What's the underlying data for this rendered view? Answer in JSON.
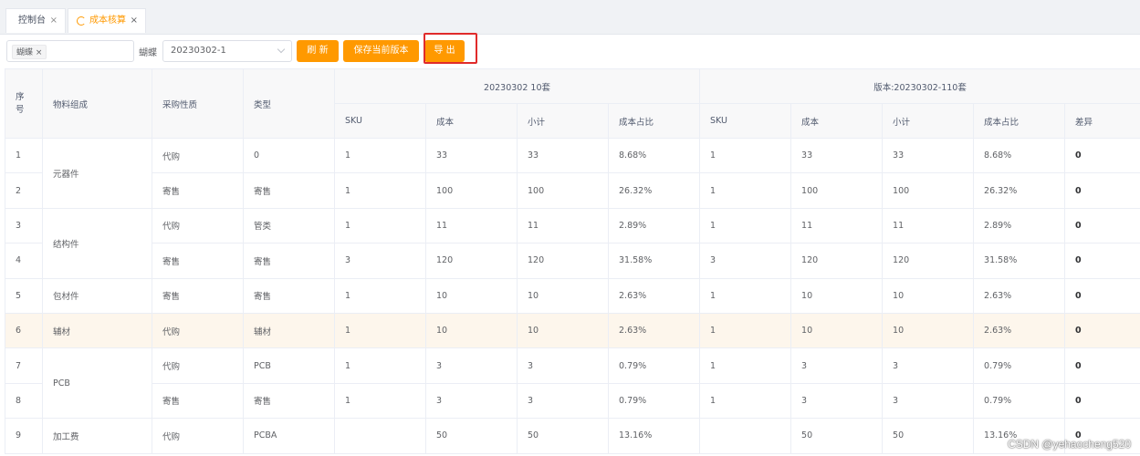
{
  "tabs": [
    {
      "label": "控制台",
      "active": false
    },
    {
      "label": "成本核算",
      "active": true
    }
  ],
  "filter": {
    "tag": "蝴蝶",
    "version_label": "蝴蝶",
    "version_value": "20230302-1"
  },
  "buttons": {
    "refresh": "刷 新",
    "save": "保存当前版本",
    "export": "导 出"
  },
  "table": {
    "headers": {
      "seq": "序号",
      "material": "物料组成",
      "purchase": "采购性质",
      "type": "类型",
      "group1": "20230302 10套",
      "group2": "版本:20230302-110套",
      "sub": [
        "SKU",
        "成本",
        "小计",
        "成本占比",
        "SKU",
        "成本",
        "小计",
        "成本占比",
        "差异"
      ]
    },
    "materials": [
      {
        "name": "元器件",
        "rows": 2
      },
      {
        "name": "结构件",
        "rows": 2
      },
      {
        "name": "包材件",
        "rows": 1
      },
      {
        "name": "辅材",
        "rows": 1
      },
      {
        "name": "PCB",
        "rows": 2
      },
      {
        "name": "加工费",
        "rows": 1
      }
    ],
    "rows": [
      {
        "seq": "1",
        "purchase": "代购",
        "type": "0",
        "sku": "1",
        "cost": "33",
        "sub": "33",
        "ratio": "8.68%",
        "sku2": "1",
        "cost2": "33",
        "sub2": "33",
        "ratio2": "8.68%",
        "diff": "0"
      },
      {
        "seq": "2",
        "purchase": "寄售",
        "type": "寄售",
        "sku": "1",
        "cost": "100",
        "sub": "100",
        "ratio": "26.32%",
        "sku2": "1",
        "cost2": "100",
        "sub2": "100",
        "ratio2": "26.32%",
        "diff": "0"
      },
      {
        "seq": "3",
        "purchase": "代购",
        "type": "管类",
        "sku": "1",
        "cost": "11",
        "sub": "11",
        "ratio": "2.89%",
        "sku2": "1",
        "cost2": "11",
        "sub2": "11",
        "ratio2": "2.89%",
        "diff": "0"
      },
      {
        "seq": "4",
        "purchase": "寄售",
        "type": "寄售",
        "sku": "3",
        "cost": "120",
        "sub": "120",
        "ratio": "31.58%",
        "sku2": "3",
        "cost2": "120",
        "sub2": "120",
        "ratio2": "31.58%",
        "diff": "0"
      },
      {
        "seq": "5",
        "purchase": "寄售",
        "type": "寄售",
        "sku": "1",
        "cost": "10",
        "sub": "10",
        "ratio": "2.63%",
        "sku2": "1",
        "cost2": "10",
        "sub2": "10",
        "ratio2": "2.63%",
        "diff": "0"
      },
      {
        "seq": "6",
        "purchase": "代购",
        "type": "辅材",
        "sku": "1",
        "cost": "10",
        "sub": "10",
        "ratio": "2.63%",
        "sku2": "1",
        "cost2": "10",
        "sub2": "10",
        "ratio2": "2.63%",
        "diff": "0",
        "highlight": true
      },
      {
        "seq": "7",
        "purchase": "代购",
        "type": "PCB",
        "sku": "1",
        "cost": "3",
        "sub": "3",
        "ratio": "0.79%",
        "sku2": "1",
        "cost2": "3",
        "sub2": "3",
        "ratio2": "0.79%",
        "diff": "0"
      },
      {
        "seq": "8",
        "purchase": "寄售",
        "type": "寄售",
        "sku": "1",
        "cost": "3",
        "sub": "3",
        "ratio": "0.79%",
        "sku2": "1",
        "cost2": "3",
        "sub2": "3",
        "ratio2": "0.79%",
        "diff": "0"
      },
      {
        "seq": "9",
        "purchase": "代购",
        "type": "PCBA",
        "sku": "",
        "cost": "50",
        "sub": "50",
        "ratio": "13.16%",
        "sku2": "",
        "cost2": "50",
        "sub2": "50",
        "ratio2": "13.16%",
        "diff": "0"
      }
    ]
  },
  "watermark": "CSDN @yehaocheng520",
  "colors": {
    "accent": "#ff9900",
    "highlight_row": "#fdf6ec",
    "annotation": "#e02b2b"
  }
}
